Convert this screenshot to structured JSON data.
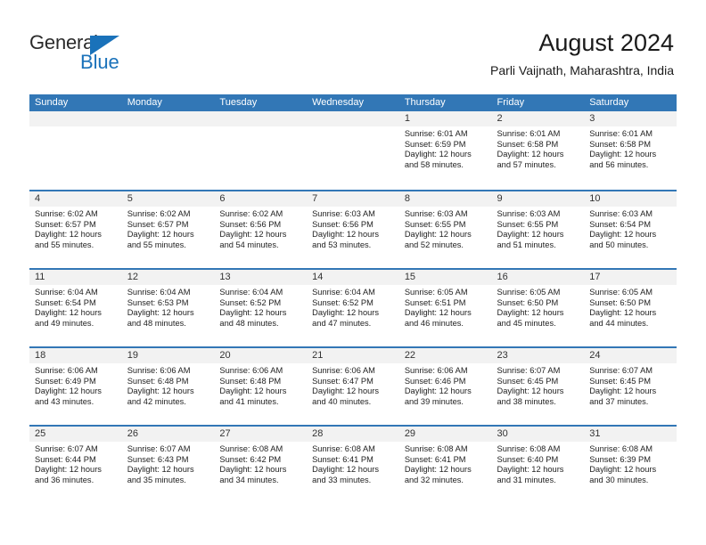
{
  "brand": {
    "name_part1": "General",
    "name_part2": "Blue",
    "accent_color": "#1a72ba"
  },
  "header": {
    "title": "August 2024",
    "subtitle": "Parli Vaijnath, Maharashtra, India"
  },
  "theme": {
    "header_blue": "#3277b6",
    "day_number_bg": "#f2f2f2"
  },
  "calendar": {
    "weekdays": [
      "Sunday",
      "Monday",
      "Tuesday",
      "Wednesday",
      "Thursday",
      "Friday",
      "Saturday"
    ],
    "weeks": [
      [
        {
          "day": "",
          "sunrise": "",
          "sunset": "",
          "daylight_line1": "",
          "daylight_line2": ""
        },
        {
          "day": "",
          "sunrise": "",
          "sunset": "",
          "daylight_line1": "",
          "daylight_line2": ""
        },
        {
          "day": "",
          "sunrise": "",
          "sunset": "",
          "daylight_line1": "",
          "daylight_line2": ""
        },
        {
          "day": "",
          "sunrise": "",
          "sunset": "",
          "daylight_line1": "",
          "daylight_line2": ""
        },
        {
          "day": "1",
          "sunrise": "Sunrise: 6:01 AM",
          "sunset": "Sunset: 6:59 PM",
          "daylight_line1": "Daylight: 12 hours",
          "daylight_line2": "and 58 minutes."
        },
        {
          "day": "2",
          "sunrise": "Sunrise: 6:01 AM",
          "sunset": "Sunset: 6:58 PM",
          "daylight_line1": "Daylight: 12 hours",
          "daylight_line2": "and 57 minutes."
        },
        {
          "day": "3",
          "sunrise": "Sunrise: 6:01 AM",
          "sunset": "Sunset: 6:58 PM",
          "daylight_line1": "Daylight: 12 hours",
          "daylight_line2": "and 56 minutes."
        }
      ],
      [
        {
          "day": "4",
          "sunrise": "Sunrise: 6:02 AM",
          "sunset": "Sunset: 6:57 PM",
          "daylight_line1": "Daylight: 12 hours",
          "daylight_line2": "and 55 minutes."
        },
        {
          "day": "5",
          "sunrise": "Sunrise: 6:02 AM",
          "sunset": "Sunset: 6:57 PM",
          "daylight_line1": "Daylight: 12 hours",
          "daylight_line2": "and 55 minutes."
        },
        {
          "day": "6",
          "sunrise": "Sunrise: 6:02 AM",
          "sunset": "Sunset: 6:56 PM",
          "daylight_line1": "Daylight: 12 hours",
          "daylight_line2": "and 54 minutes."
        },
        {
          "day": "7",
          "sunrise": "Sunrise: 6:03 AM",
          "sunset": "Sunset: 6:56 PM",
          "daylight_line1": "Daylight: 12 hours",
          "daylight_line2": "and 53 minutes."
        },
        {
          "day": "8",
          "sunrise": "Sunrise: 6:03 AM",
          "sunset": "Sunset: 6:55 PM",
          "daylight_line1": "Daylight: 12 hours",
          "daylight_line2": "and 52 minutes."
        },
        {
          "day": "9",
          "sunrise": "Sunrise: 6:03 AM",
          "sunset": "Sunset: 6:55 PM",
          "daylight_line1": "Daylight: 12 hours",
          "daylight_line2": "and 51 minutes."
        },
        {
          "day": "10",
          "sunrise": "Sunrise: 6:03 AM",
          "sunset": "Sunset: 6:54 PM",
          "daylight_line1": "Daylight: 12 hours",
          "daylight_line2": "and 50 minutes."
        }
      ],
      [
        {
          "day": "11",
          "sunrise": "Sunrise: 6:04 AM",
          "sunset": "Sunset: 6:54 PM",
          "daylight_line1": "Daylight: 12 hours",
          "daylight_line2": "and 49 minutes."
        },
        {
          "day": "12",
          "sunrise": "Sunrise: 6:04 AM",
          "sunset": "Sunset: 6:53 PM",
          "daylight_line1": "Daylight: 12 hours",
          "daylight_line2": "and 48 minutes."
        },
        {
          "day": "13",
          "sunrise": "Sunrise: 6:04 AM",
          "sunset": "Sunset: 6:52 PM",
          "daylight_line1": "Daylight: 12 hours",
          "daylight_line2": "and 48 minutes."
        },
        {
          "day": "14",
          "sunrise": "Sunrise: 6:04 AM",
          "sunset": "Sunset: 6:52 PM",
          "daylight_line1": "Daylight: 12 hours",
          "daylight_line2": "and 47 minutes."
        },
        {
          "day": "15",
          "sunrise": "Sunrise: 6:05 AM",
          "sunset": "Sunset: 6:51 PM",
          "daylight_line1": "Daylight: 12 hours",
          "daylight_line2": "and 46 minutes."
        },
        {
          "day": "16",
          "sunrise": "Sunrise: 6:05 AM",
          "sunset": "Sunset: 6:50 PM",
          "daylight_line1": "Daylight: 12 hours",
          "daylight_line2": "and 45 minutes."
        },
        {
          "day": "17",
          "sunrise": "Sunrise: 6:05 AM",
          "sunset": "Sunset: 6:50 PM",
          "daylight_line1": "Daylight: 12 hours",
          "daylight_line2": "and 44 minutes."
        }
      ],
      [
        {
          "day": "18",
          "sunrise": "Sunrise: 6:06 AM",
          "sunset": "Sunset: 6:49 PM",
          "daylight_line1": "Daylight: 12 hours",
          "daylight_line2": "and 43 minutes."
        },
        {
          "day": "19",
          "sunrise": "Sunrise: 6:06 AM",
          "sunset": "Sunset: 6:48 PM",
          "daylight_line1": "Daylight: 12 hours",
          "daylight_line2": "and 42 minutes."
        },
        {
          "day": "20",
          "sunrise": "Sunrise: 6:06 AM",
          "sunset": "Sunset: 6:48 PM",
          "daylight_line1": "Daylight: 12 hours",
          "daylight_line2": "and 41 minutes."
        },
        {
          "day": "21",
          "sunrise": "Sunrise: 6:06 AM",
          "sunset": "Sunset: 6:47 PM",
          "daylight_line1": "Daylight: 12 hours",
          "daylight_line2": "and 40 minutes."
        },
        {
          "day": "22",
          "sunrise": "Sunrise: 6:06 AM",
          "sunset": "Sunset: 6:46 PM",
          "daylight_line1": "Daylight: 12 hours",
          "daylight_line2": "and 39 minutes."
        },
        {
          "day": "23",
          "sunrise": "Sunrise: 6:07 AM",
          "sunset": "Sunset: 6:45 PM",
          "daylight_line1": "Daylight: 12 hours",
          "daylight_line2": "and 38 minutes."
        },
        {
          "day": "24",
          "sunrise": "Sunrise: 6:07 AM",
          "sunset": "Sunset: 6:45 PM",
          "daylight_line1": "Daylight: 12 hours",
          "daylight_line2": "and 37 minutes."
        }
      ],
      [
        {
          "day": "25",
          "sunrise": "Sunrise: 6:07 AM",
          "sunset": "Sunset: 6:44 PM",
          "daylight_line1": "Daylight: 12 hours",
          "daylight_line2": "and 36 minutes."
        },
        {
          "day": "26",
          "sunrise": "Sunrise: 6:07 AM",
          "sunset": "Sunset: 6:43 PM",
          "daylight_line1": "Daylight: 12 hours",
          "daylight_line2": "and 35 minutes."
        },
        {
          "day": "27",
          "sunrise": "Sunrise: 6:08 AM",
          "sunset": "Sunset: 6:42 PM",
          "daylight_line1": "Daylight: 12 hours",
          "daylight_line2": "and 34 minutes."
        },
        {
          "day": "28",
          "sunrise": "Sunrise: 6:08 AM",
          "sunset": "Sunset: 6:41 PM",
          "daylight_line1": "Daylight: 12 hours",
          "daylight_line2": "and 33 minutes."
        },
        {
          "day": "29",
          "sunrise": "Sunrise: 6:08 AM",
          "sunset": "Sunset: 6:41 PM",
          "daylight_line1": "Daylight: 12 hours",
          "daylight_line2": "and 32 minutes."
        },
        {
          "day": "30",
          "sunrise": "Sunrise: 6:08 AM",
          "sunset": "Sunset: 6:40 PM",
          "daylight_line1": "Daylight: 12 hours",
          "daylight_line2": "and 31 minutes."
        },
        {
          "day": "31",
          "sunrise": "Sunrise: 6:08 AM",
          "sunset": "Sunset: 6:39 PM",
          "daylight_line1": "Daylight: 12 hours",
          "daylight_line2": "and 30 minutes."
        }
      ]
    ]
  }
}
